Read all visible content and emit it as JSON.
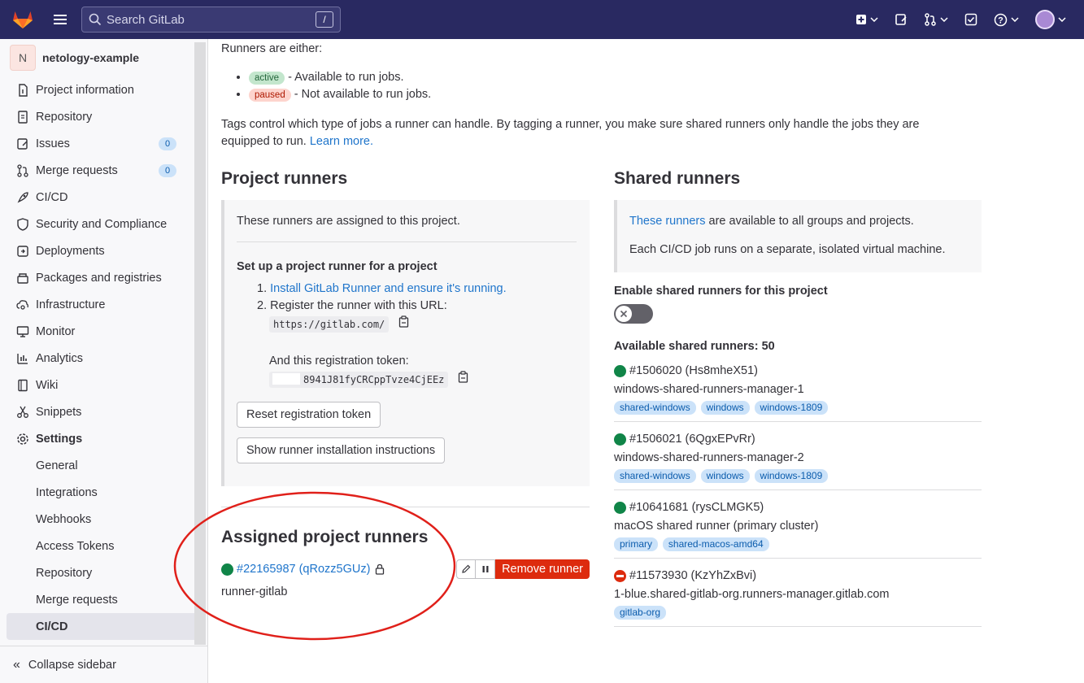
{
  "topbar": {
    "search_placeholder": "Search GitLab",
    "search_shortcut": "/"
  },
  "sidebar": {
    "project_initial": "N",
    "project_name": "netology-example",
    "items": [
      {
        "label": "Project information",
        "icon": "info-icon"
      },
      {
        "label": "Repository",
        "icon": "document-icon"
      },
      {
        "label": "Issues",
        "icon": "issues-icon",
        "count": "0"
      },
      {
        "label": "Merge requests",
        "icon": "merge-request-icon",
        "count": "0"
      },
      {
        "label": "CI/CD",
        "icon": "rocket-icon"
      },
      {
        "label": "Security and Compliance",
        "icon": "shield-icon"
      },
      {
        "label": "Deployments",
        "icon": "deployments-icon"
      },
      {
        "label": "Packages and registries",
        "icon": "package-icon"
      },
      {
        "label": "Infrastructure",
        "icon": "cloud-gear-icon"
      },
      {
        "label": "Monitor",
        "icon": "monitor-icon"
      },
      {
        "label": "Analytics",
        "icon": "chart-icon"
      },
      {
        "label": "Wiki",
        "icon": "book-icon"
      },
      {
        "label": "Snippets",
        "icon": "scissors-icon"
      },
      {
        "label": "Settings",
        "icon": "gear-icon"
      }
    ],
    "settings_sub": [
      "General",
      "Integrations",
      "Webhooks",
      "Access Tokens",
      "Repository",
      "Merge requests",
      "CI/CD"
    ],
    "collapse_label": "Collapse sidebar"
  },
  "intro": {
    "runners_either": "Runners are either:",
    "active_pill": "active",
    "active_text": "- Available to run jobs.",
    "paused_pill": "paused",
    "paused_text": "- Not available to run jobs.",
    "tags_text": "Tags control which type of jobs a runner can handle. By tagging a runner, you make sure shared runners only handle the jobs they are equipped to run.",
    "learn_more": "Learn more."
  },
  "project_runners": {
    "title": "Project runners",
    "assigned_text": "These runners are assigned to this project.",
    "setup_title": "Set up a project runner for a project",
    "step1_link": "Install GitLab Runner and ensure it's running.",
    "step2_text": "Register the runner with this URL:",
    "url": "https://gitlab.com/",
    "token_label": "And this registration token:",
    "token": "8941J81fyCRCppTvze4CjEEz",
    "reset_button": "Reset registration token",
    "show_instructions_button": "Show runner installation instructions"
  },
  "assigned_runners": {
    "title": "Assigned project runners",
    "runner_link": "#22165987 (qRozz5GUz)",
    "runner_desc": "runner-gitlab",
    "remove_button": "Remove runner"
  },
  "shared_runners": {
    "title": "Shared runners",
    "these_runners_link": "These runners",
    "available_text": "are available to all groups and projects.",
    "vm_text": "Each CI/CD job runs on a separate, isolated virtual machine.",
    "enable_label": "Enable shared runners for this project",
    "available_count": "Available shared runners: 50",
    "list": [
      {
        "id": "#1506020 (Hs8mheX51)",
        "status": "online",
        "desc": "windows-shared-runners-manager-1",
        "tags": [
          "shared-windows",
          "windows",
          "windows-1809"
        ]
      },
      {
        "id": "#1506021 (6QgxEPvRr)",
        "status": "online",
        "desc": "windows-shared-runners-manager-2",
        "tags": [
          "shared-windows",
          "windows",
          "windows-1809"
        ]
      },
      {
        "id": "#10641681 (rysCLMGK5)",
        "status": "online",
        "desc": "macOS shared runner (primary cluster)",
        "tags": [
          "primary",
          "shared-macos-amd64"
        ]
      },
      {
        "id": "#11573930 (KzYhZxBvi)",
        "status": "paused",
        "desc": "1-blue.shared-gitlab-org.runners-manager.gitlab.com",
        "tags": [
          "gitlab-org"
        ]
      }
    ]
  },
  "colors": {
    "topbar": "#292961",
    "online": "#108548",
    "danger": "#dd2b0e",
    "link": "#1f75cb",
    "annotation": "#e0201a"
  }
}
